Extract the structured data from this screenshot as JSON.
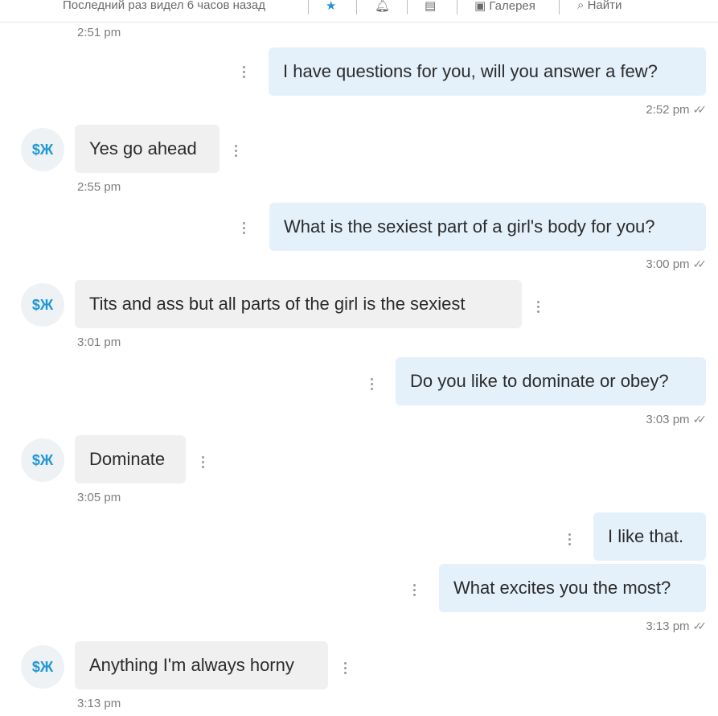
{
  "header": {
    "last_seen": "Последний раз видел 6 часов назад",
    "gallery": "Галерея",
    "search": "Найти"
  },
  "contact": {
    "avatar_initials": "$Ж"
  },
  "messages": [
    {
      "type": "time",
      "text": "2:51 pm"
    },
    {
      "type": "out",
      "text": "I have questions for you, will you answer a few?",
      "time": "2:52 pm"
    },
    {
      "type": "in",
      "text": "Yes go ahead",
      "time": "2:55 pm"
    },
    {
      "type": "out",
      "text": "What is the sexiest part of a girl's body for you?",
      "time": "3:00 pm"
    },
    {
      "type": "in",
      "text": "Tits and ass but all parts of the girl is the sexiest",
      "time": "3:01 pm"
    },
    {
      "type": "out",
      "text": "Do you like to dominate or obey?",
      "time": "3:03 pm"
    },
    {
      "type": "in",
      "text": "Dominate",
      "time": "3:05 pm"
    },
    {
      "type": "out",
      "text": "I like that."
    },
    {
      "type": "out",
      "text": "What excites you the most?",
      "time": "3:13 pm"
    },
    {
      "type": "in",
      "text": "Anything I'm always horny",
      "time": "3:13 pm"
    }
  ]
}
